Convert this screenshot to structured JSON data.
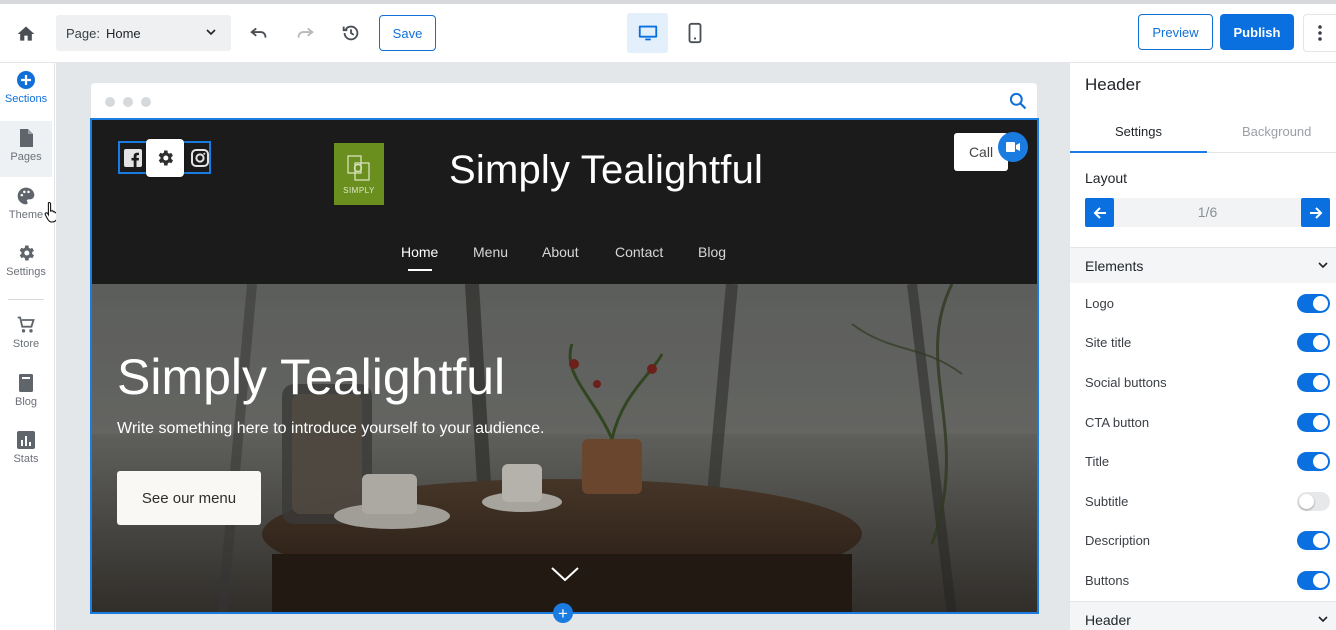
{
  "toolbar": {
    "page_label": "Page:",
    "page_value": "Home",
    "save_label": "Save",
    "preview_label": "Preview",
    "publish_label": "Publish"
  },
  "rail": {
    "items": [
      {
        "label": "Sections",
        "icon": "plus-circle-icon"
      },
      {
        "label": "Pages",
        "icon": "page-icon"
      },
      {
        "label": "Theme",
        "icon": "palette-icon"
      },
      {
        "label": "Settings",
        "icon": "gear-icon"
      },
      {
        "label": "Store",
        "icon": "cart-icon"
      },
      {
        "label": "Blog",
        "icon": "book-icon"
      },
      {
        "label": "Stats",
        "icon": "bar-chart-icon"
      }
    ]
  },
  "site": {
    "logo_text": "SIMPLY",
    "title": "Simply Tealightful",
    "call_label": "Call",
    "nav": [
      "Home",
      "Menu",
      "About",
      "Contact",
      "Blog"
    ],
    "hero_title": "Simply Tealightful",
    "hero_subtitle": "Write something here to introduce yourself to your audience.",
    "hero_button": "See our menu"
  },
  "panel": {
    "title": "Header",
    "tabs": [
      "Settings",
      "Background"
    ],
    "layout_label": "Layout",
    "layout_value": "1/6",
    "elements_label": "Elements",
    "header_label": "Header",
    "toggles": [
      {
        "label": "Logo",
        "on": true
      },
      {
        "label": "Site title",
        "on": true
      },
      {
        "label": "Social buttons",
        "on": true
      },
      {
        "label": "CTA button",
        "on": true
      },
      {
        "label": "Title",
        "on": true
      },
      {
        "label": "Subtitle",
        "on": false
      },
      {
        "label": "Description",
        "on": true
      },
      {
        "label": "Buttons",
        "on": true
      }
    ]
  },
  "colors": {
    "accent": "#0a70e0",
    "site_header_bg": "#1c1b1c",
    "logo_bg": "#6a8f1e"
  }
}
